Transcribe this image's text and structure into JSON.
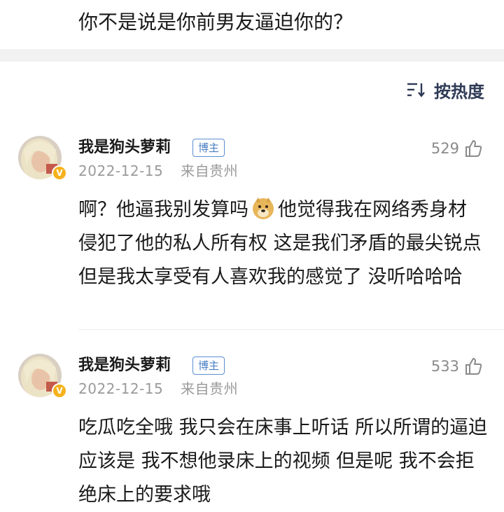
{
  "post": {
    "text": "你不是说是你前男友逼迫你的？"
  },
  "sort": {
    "label": "按热度"
  },
  "comments": [
    {
      "username": "我是狗头萝莉",
      "badge": "博主",
      "date": "2022-12-15",
      "location": "来自贵州",
      "likes": "529",
      "text_part1": "啊？他逼我别发算吗",
      "emoji": "doge-emoji",
      "text_part2": "他觉得我在网络秀身材 侵犯了他的私人所有权 这是我们矛盾的最尖锐点 但是我太享受有人喜欢我的感觉了 没听哈哈哈"
    },
    {
      "username": "我是狗头萝莉",
      "badge": "博主",
      "date": "2022-12-15",
      "location": "来自贵州",
      "likes": "533",
      "text": "吃瓜吃全哦 我只会在床事上听话 所以所谓的逼迫 应该是 我不想他录床上的视频 但是呢 我不会拒绝床上的要求哦"
    }
  ],
  "icons": {
    "sort": "sort-lines-icon",
    "like": "thumbs-up-icon",
    "verified": "verified-badge-icon"
  },
  "colors": {
    "badge": "#4a7fc4",
    "verified": "#f5b21c",
    "meta": "#9a9a9a"
  }
}
